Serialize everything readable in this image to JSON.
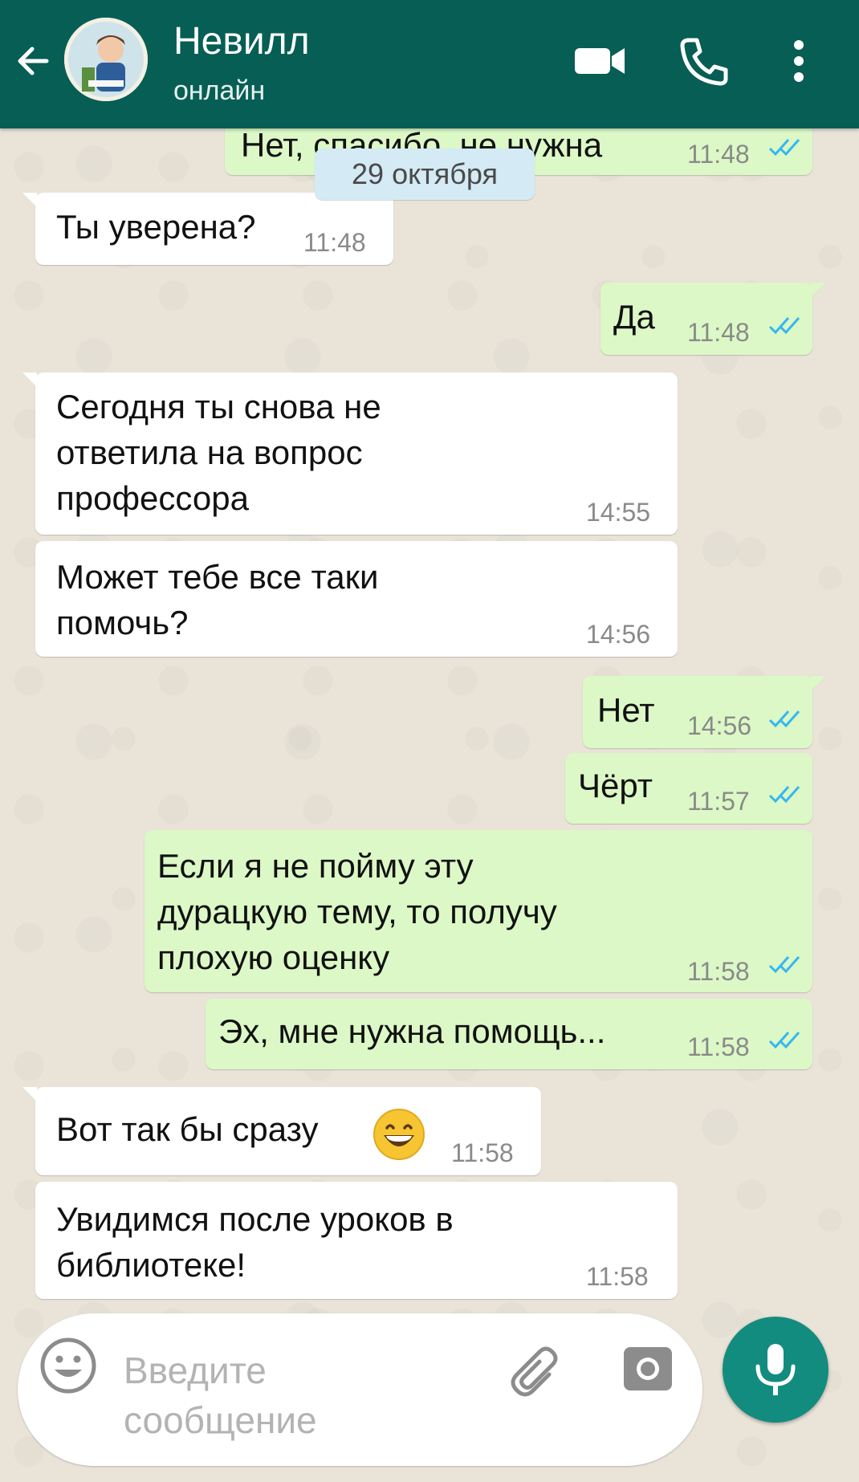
{
  "header": {
    "title": "Невилл",
    "status": "онлайн",
    "color": "#075e54"
  },
  "date_divider": "29 октября",
  "messages": [
    {
      "direction": "out",
      "text": "Нет, спасибо, не нужна",
      "time": "11:48",
      "status": "read"
    },
    {
      "direction": "in",
      "text": "Ты уверена?",
      "time": "11:48"
    },
    {
      "direction": "out",
      "text": "Да",
      "time": "11:48",
      "status": "read"
    },
    {
      "direction": "in",
      "text": "Сегодня ты снова не\nответила на вопрос\nпрофессора",
      "time": "14:55"
    },
    {
      "direction": "in",
      "text": "Может тебе все таки\nпомочь?",
      "time": "14:56"
    },
    {
      "direction": "out",
      "text": "Нет",
      "time": "14:56",
      "status": "read"
    },
    {
      "direction": "out",
      "text": "Чёрт",
      "time": "11:57",
      "status": "read"
    },
    {
      "direction": "out",
      "text": "Если я не пойму эту\nдурацкую тему, то получу\nплохую оценку",
      "time": "11:58",
      "status": "read"
    },
    {
      "direction": "out",
      "text": "Эх, мне нужна помощь...",
      "time": "11:58",
      "status": "read"
    },
    {
      "direction": "in",
      "text": "Вот так бы сразу",
      "emoji": "grinning-face",
      "time": "11:58"
    },
    {
      "direction": "in",
      "text": "Увидимся после уроков в\nбиблиотеке!",
      "time": "11:58"
    }
  ],
  "input": {
    "placeholder": "Введите\nсообщение"
  },
  "colors": {
    "incoming_bubble": "#ffffff",
    "outgoing_bubble": "#dcf8c6",
    "read_ticks": "#34b7f1",
    "mic_button": "#128c7e"
  }
}
